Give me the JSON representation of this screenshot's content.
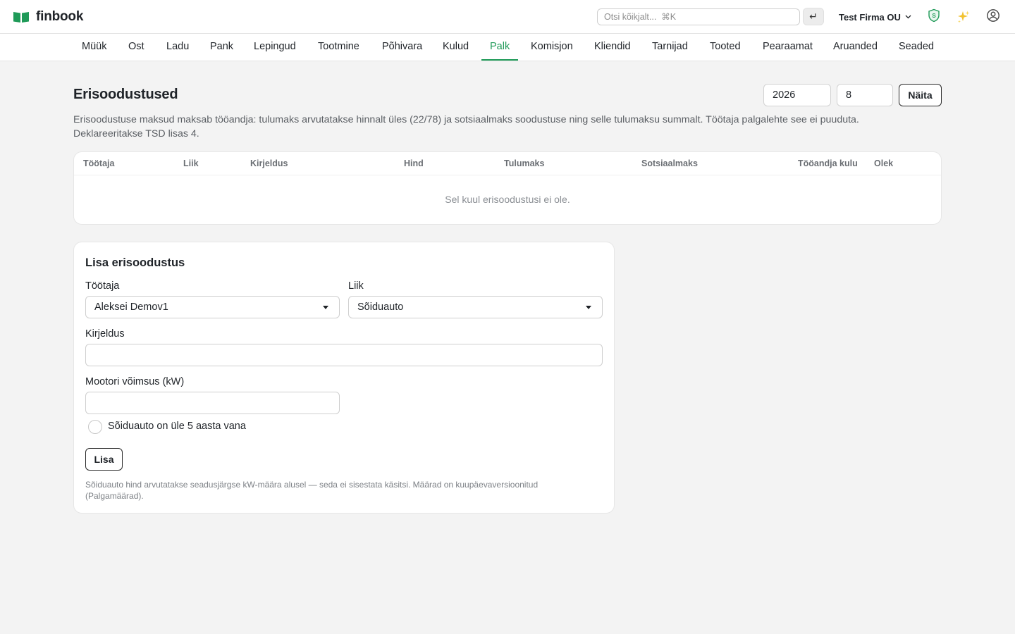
{
  "app": {
    "name": "finbook",
    "brand_color": "#1f9a58"
  },
  "topbar": {
    "search_placeholder": "Otsi kõikjalt...  ⌘K",
    "enter_symbol": "↵",
    "company": "Test Firma OU",
    "shield_letter": "S"
  },
  "nav": {
    "items": [
      "Müük",
      "Ost",
      "Ladu",
      "Pank",
      "Lepingud",
      "Tootmine",
      "Põhivara",
      "Kulud",
      "Palk",
      "Komisjon",
      "Kliendid",
      "Tarnijad",
      "Tooted",
      "Pearaamat",
      "Aruanded",
      "Seaded"
    ],
    "active": "Palk"
  },
  "page": {
    "title": "Erisoodustused",
    "year": "2026",
    "month": "8",
    "show_label": "Näita",
    "description": "Erisoodustuse maksud maksab tööandja: tulumaks arvutatakse hinnalt üles (22/78) ja sotsiaalmaks soodustuse ning selle tulumaksu summalt. Töötaja palgalehte see ei puuduta. Deklareeritakse TSD lisas 4."
  },
  "table": {
    "columns": [
      "Töötaja",
      "Liik",
      "Kirjeldus",
      "Hind",
      "Tulumaks",
      "Sotsiaalmaks",
      "Tööandja kulu",
      "Olek"
    ],
    "empty_text": "Sel kuul erisoodustusi ei ole."
  },
  "form": {
    "title": "Lisa erisoodustus",
    "employee_label": "Töötaja",
    "employee_value": "Aleksei Demov1",
    "type_label": "Liik",
    "type_value": "Sõiduauto",
    "description_label": "Kirjeldus",
    "description_value": "",
    "power_label": "Mootori võimsus (kW)",
    "power_value": "",
    "checkbox_label": "Sõiduauto on üle 5 aasta vana",
    "checkbox_checked": false,
    "add_label": "Lisa",
    "hint": "Sõiduauto hind arvutatakse seadusjärgse kW-määra alusel — seda ei sisestata käsitsi. Määrad on kuupäevaversioonitud (Palgamäärad)."
  }
}
